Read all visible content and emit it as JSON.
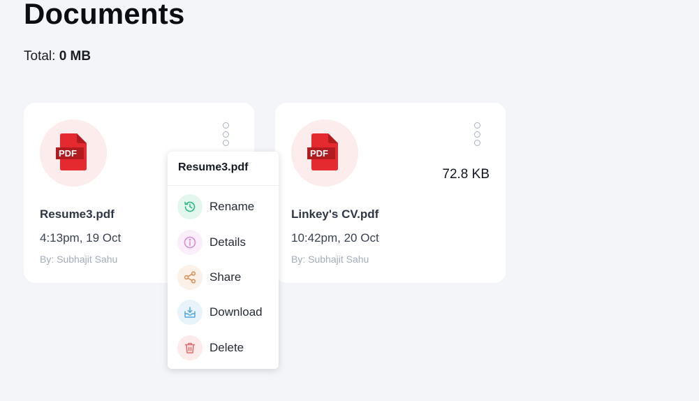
{
  "page": {
    "title": "Documents",
    "total_label": "Total:",
    "total_value": "0 MB"
  },
  "files": [
    {
      "badge": "PDF",
      "name": "Resume3.pdf",
      "date": "4:13pm, 19 Oct",
      "author": "By: Subhajit Sahu",
      "size": ""
    },
    {
      "badge": "PDF",
      "name": "Linkey's CV.pdf",
      "date": "10:42pm, 20 Oct",
      "author": "By: Subhajit Sahu",
      "size": "72.8 KB"
    }
  ],
  "context_menu": {
    "title": "Resume3.pdf",
    "items": [
      {
        "label": "Rename",
        "icon": "rename-history-icon",
        "color": "#2bb98a",
        "bg": "#e4f7ef"
      },
      {
        "label": "Details",
        "icon": "info-icon",
        "color": "#d48ad8",
        "bg": "#fbeefb"
      },
      {
        "label": "Share",
        "icon": "share-icon",
        "color": "#d98e55",
        "bg": "#fcf1e8"
      },
      {
        "label": "Download",
        "icon": "download-icon",
        "color": "#54a6e0",
        "bg": "#e8f3fc"
      },
      {
        "label": "Delete",
        "icon": "trash-icon",
        "color": "#e36a6a",
        "bg": "#fdeaea"
      }
    ]
  },
  "colors": {
    "pdf_red": "#e52a2f",
    "pdf_dark": "#b01c20",
    "pdf_circle_bg": "#fdecec"
  }
}
